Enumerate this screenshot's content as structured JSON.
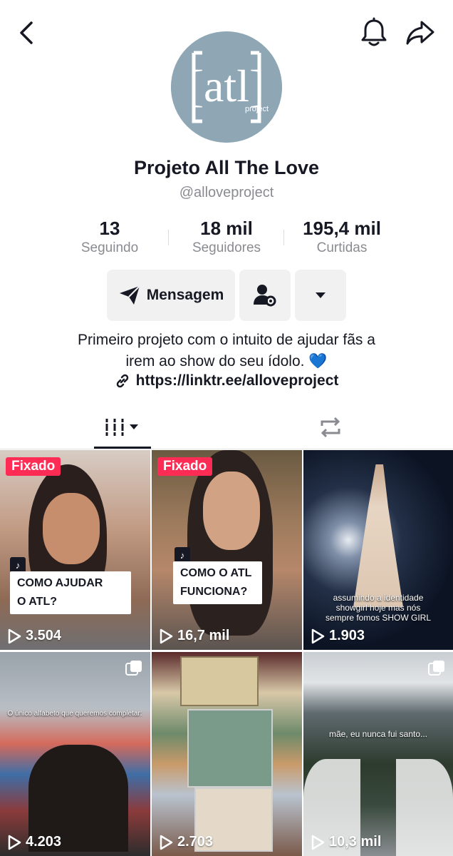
{
  "header": {
    "back_icon": "chevron-left-icon",
    "bell_icon": "bell-icon",
    "share_icon": "share-arrow-icon"
  },
  "profile": {
    "avatar_letters": "[atl]",
    "avatar_sub": "project",
    "name": "Projeto All The Love",
    "handle": "@alloveproject"
  },
  "stats": [
    {
      "value": "13",
      "label": "Seguindo"
    },
    {
      "value": "18 mil",
      "label": "Seguidores"
    },
    {
      "value": "195,4 mil",
      "label": "Curtidas"
    }
  ],
  "actions": {
    "message_label": "Mensagem",
    "message_icon": "send-icon",
    "follow_icon": "person-gear-icon",
    "more_icon": "caret-down-icon"
  },
  "bio": {
    "line1": "Primeiro projeto com o intuito de ajudar fãs a",
    "line2": "irem ao show do seu ídolo. 💙",
    "link_icon": "link-icon",
    "link": "https://linktr.ee/alloveproject"
  },
  "tabs": {
    "videos_icon": "grid-videos-icon",
    "reposts_icon": "repost-icon"
  },
  "videos": [
    {
      "pinned": "Fixado",
      "caption": "COMO AJUDAR O ATL?",
      "caption_l1": "COMO AJUDAR",
      "caption_l2": "O ATL?",
      "views": "3.504"
    },
    {
      "pinned": "Fixado",
      "caption": "COMO O ATL FUNCIONA?",
      "caption_l1": "COMO O ATL",
      "caption_l2": "FUNCIONA?",
      "views": "16,7 mil"
    },
    {
      "overlay_l1": "assumindo a identidade",
      "overlay_l2": "showgirl hoje mas nós",
      "overlay_l3": "sempre fomos SHOW GIRL",
      "views": "1.903"
    },
    {
      "overlay_l1": "O único alfabeto que queremos completar:",
      "views": "4.203"
    },
    {
      "views": "2.703"
    },
    {
      "overlay_l1": "mãe, eu nunca fui santo...",
      "views": "10,3 mil"
    }
  ],
  "colors": {
    "pin_red": "#fe2c55",
    "text_primary": "#161823",
    "text_secondary": "#8a8b91",
    "button_bg": "#f1f1f2",
    "avatar_bg": "#8fa6b5"
  }
}
